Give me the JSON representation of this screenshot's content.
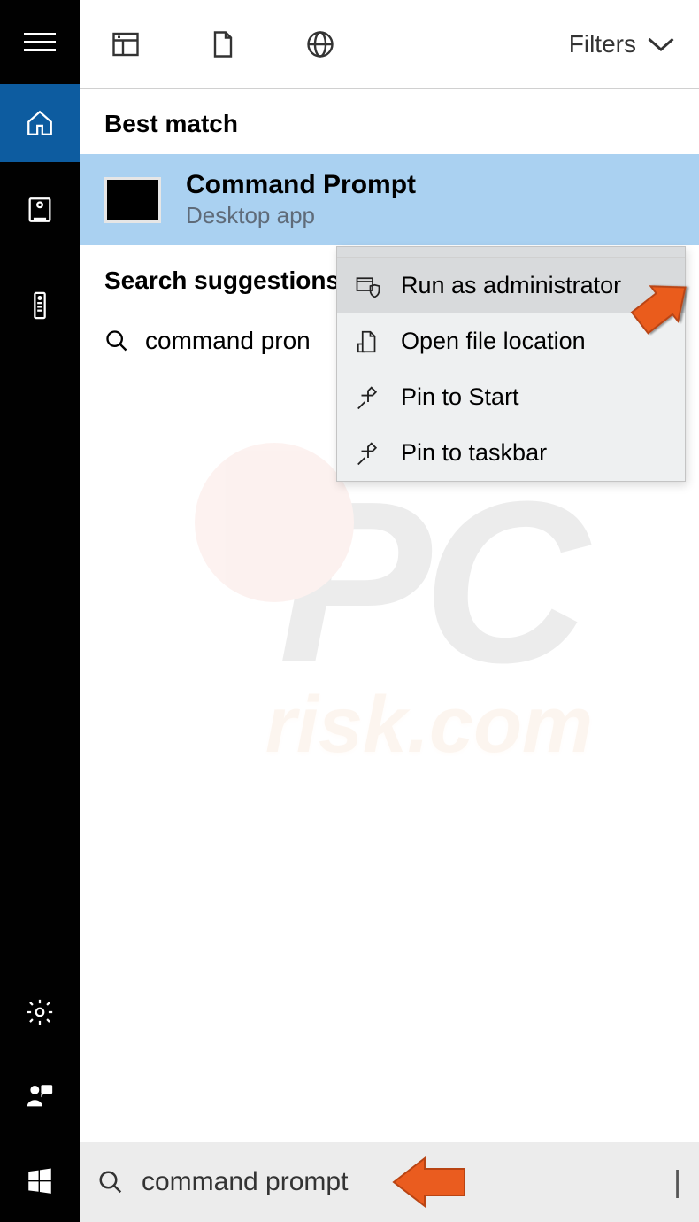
{
  "topbar": {
    "filters_label": "Filters"
  },
  "sections": {
    "best_match_label": "Best match",
    "suggestions_label": "Search suggestions"
  },
  "result": {
    "title": "Command Prompt",
    "subtitle": "Desktop app"
  },
  "suggestion": {
    "text": "command pron"
  },
  "context_menu": {
    "items": [
      {
        "label": "Run as administrator",
        "icon": "admin-shield-icon",
        "hover": true
      },
      {
        "label": "Open file location",
        "icon": "file-location-icon",
        "hover": false
      },
      {
        "label": "Pin to Start",
        "icon": "pin-icon",
        "hover": false
      },
      {
        "label": "Pin to taskbar",
        "icon": "pin-icon",
        "hover": false
      }
    ]
  },
  "searchbar": {
    "value": "command prompt"
  },
  "watermark": {
    "pc": "PC",
    "risk": "risk.com"
  }
}
